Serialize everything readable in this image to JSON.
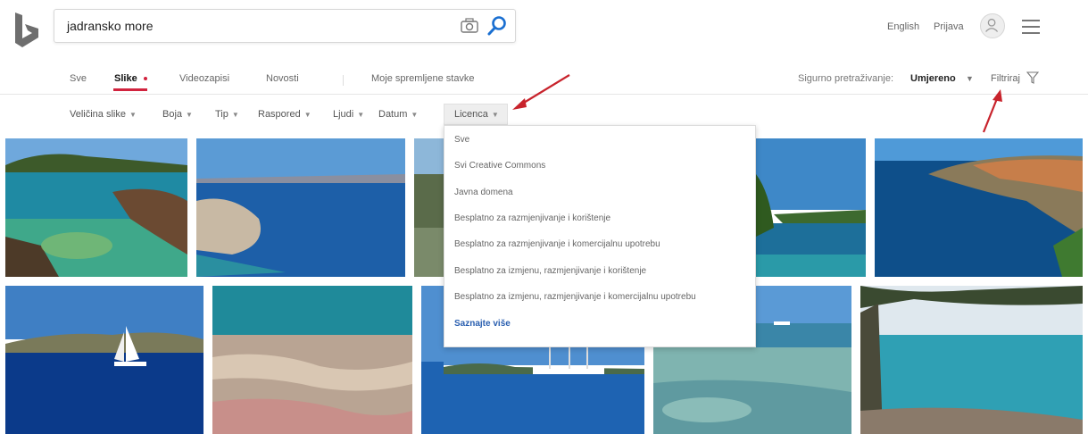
{
  "header": {
    "search_value": "jadransko more",
    "language": "English",
    "signin": "Prijava"
  },
  "tabs": [
    {
      "label": "Sve"
    },
    {
      "label": "Slike"
    },
    {
      "label": "Videozapisi"
    },
    {
      "label": "Novosti"
    },
    {
      "label": "Moje spremljene stavke"
    }
  ],
  "safesearch": {
    "label": "Sigurno pretraživanje:",
    "value": "Umjereno"
  },
  "filter_label": "Filtriraj",
  "filters": [
    {
      "label": "Veličina slike"
    },
    {
      "label": "Boja"
    },
    {
      "label": "Tip"
    },
    {
      "label": "Raspored"
    },
    {
      "label": "Ljudi"
    },
    {
      "label": "Datum"
    },
    {
      "label": "Licenca"
    }
  ],
  "license_menu": [
    "Sve",
    "Svi Creative Commons",
    "Javna domena",
    "Besplatno za razmjenjivanje i korištenje",
    "Besplatno za razmjenjivanje i komercijalnu upotrebu",
    "Besplatno za izmjenu, razmjenjivanje i korištenje",
    "Besplatno za izmjenu, razmjenjivanje i komercijalnu upotrebu"
  ],
  "license_more": "Saznajte više",
  "colors": {
    "accent": "#d1233e",
    "link": "#2a5fb0",
    "search_icon": "#1a6fd1",
    "annotation_arrow": "#c8232c"
  }
}
